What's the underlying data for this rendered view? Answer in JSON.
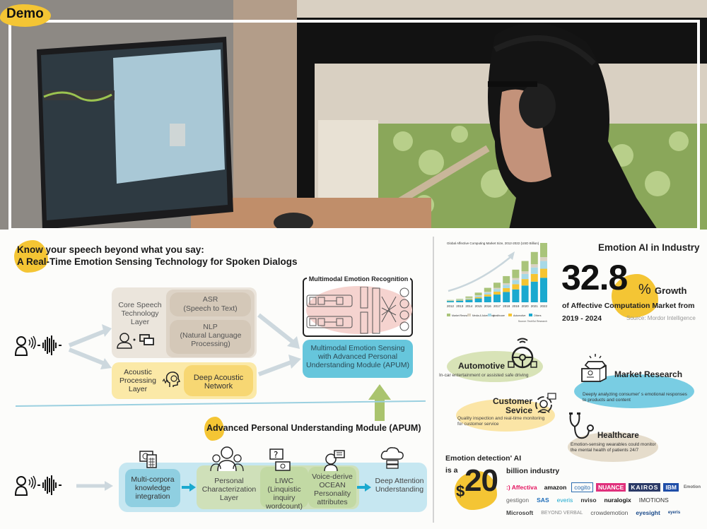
{
  "demo": {
    "label": "Demo"
  },
  "header": {
    "line1": "Know your speech beyond what you say:",
    "line2": "A Real-Time Emotion Sensing Technology for Spoken Dialogs"
  },
  "pipeline": {
    "core_layer": "Core Speech Technology Layer",
    "asr_title": "ASR",
    "asr_sub": "(Speech to Text)",
    "nlp_title": "NLP",
    "nlp_sub": "(Natural Language Processing)",
    "acoustic_layer": "Acoustic Processing Layer",
    "deep_acoustic": "Deep Acoustic Network",
    "mer_title": "Multimodal Emotion Recognition",
    "mmes": "Multimodal Emotion Sensing with Advanced Personal Understanding Module (APUM)"
  },
  "apum": {
    "title": "Advanced Personal Understanding Module (APUM)",
    "multi_corpora": "Multi-corpora knowledge integration",
    "personal_char": "Personal Characterization Layer",
    "liwc": "LIWC (Linquistic inquiry wordcount)",
    "ocean": "Voice-derive OCEAN Personality attributes",
    "deep_attention": "Deep Attention Understanding"
  },
  "industry": {
    "title": "Emotion AI in Industry",
    "growth_value": "32.8",
    "growth_unit": "%",
    "growth_label": "Growth",
    "growth_desc": "of Affective Computation Market from",
    "growth_period": "2019 - 2024",
    "source": "Source: Mordor Intelligence"
  },
  "chart_data": {
    "type": "bar",
    "title": "Global Affective Computing Market Size, 2012-2022 (USD Billion)",
    "categories": [
      "2012",
      "2013",
      "2014",
      "2015",
      "2016",
      "2017",
      "2018",
      "2019",
      "2020",
      "2021",
      "2022"
    ],
    "series": [
      {
        "name": "Others",
        "color": "#1ba9cf",
        "values": [
          1,
          1.3,
          2,
          3,
          4.5,
          6,
          8,
          10,
          13,
          16,
          19
        ]
      },
      {
        "name": "Automotive",
        "color": "#f6c431",
        "values": [
          0.2,
          0.3,
          0.6,
          1,
          1.5,
          2.2,
          3,
          4,
          5,
          6,
          7
        ]
      },
      {
        "name": "Healthcare",
        "color": "#a7d9e6",
        "values": [
          0.2,
          0.3,
          0.6,
          1,
          1.5,
          2,
          2.5,
          3.2,
          4,
          5,
          6
        ]
      },
      {
        "name": "Media & Advertising",
        "color": "#d9d2c3",
        "values": [
          0.1,
          0.2,
          0.3,
          0.5,
          0.7,
          1,
          1.3,
          1.6,
          2,
          2.5,
          3
        ]
      },
      {
        "name": "Market Research",
        "color": "#a9c47a",
        "values": [
          0.3,
          0.5,
          1,
          2,
          3,
          4,
          5.5,
          6.5,
          8,
          9.5,
          11
        ]
      }
    ],
    "source": "Source: TechSci Research"
  },
  "sectors": [
    {
      "name": "Automotive",
      "desc": "In-car entertainment or assisted safe driving"
    },
    {
      "name": "Customer Sevice",
      "desc": "Quality inspection and real-time monitoring for customer service"
    },
    {
      "name": "Market Research",
      "desc": "Deeply analyzing consumer' s emotional responses to products and content"
    },
    {
      "name": "Healthcare",
      "desc": "Emotion-sensing wearables could monitor the mental health of patients 24/7"
    }
  ],
  "market": {
    "line1": "Emotion detection' AI",
    "line2": "is a",
    "currency": "$",
    "amount": "20",
    "line3": "billion industry"
  },
  "logos": [
    ":) Affectiva",
    "amazon",
    "cogito",
    "NUANCE",
    "KAIROS",
    "IBM",
    "Emotion",
    "gestigon",
    "SAS",
    "everis",
    "nviso",
    "nuralogix",
    "IMOTIONS",
    "Microsoft",
    "BEYOND VERBAL",
    "crowdemotion",
    "eyesight",
    "eyeris"
  ]
}
